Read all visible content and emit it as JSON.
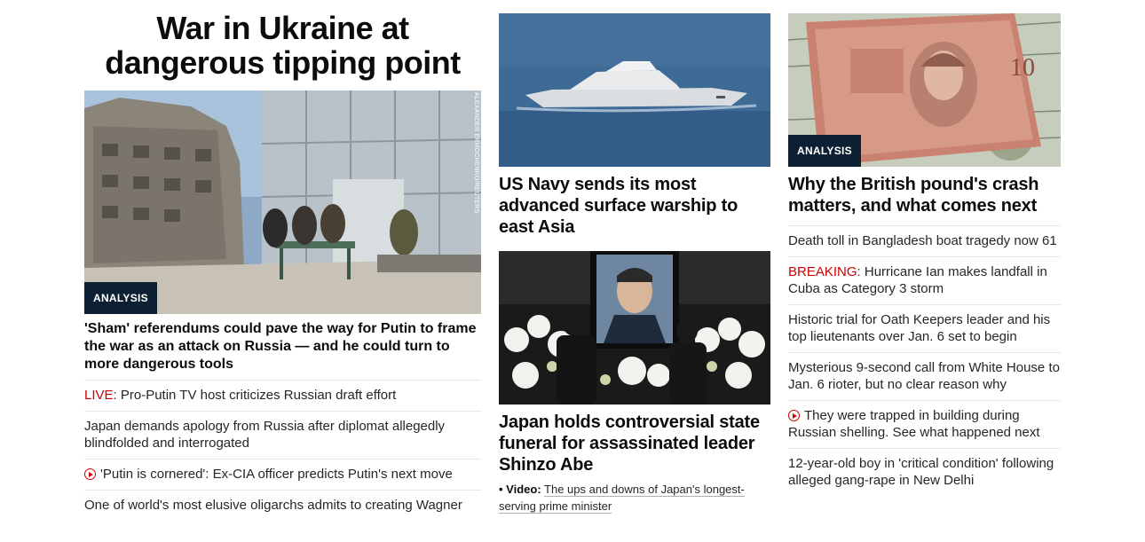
{
  "col1": {
    "headline": "War in Ukraine at dangerous tipping point",
    "image_credit": "ALEXANDER ERMOCHENKO/REUTERS",
    "badge": "ANALYSIS",
    "lead": "'Sham' referendums could pave the way for Putin to frame the war as an attack on Russia — and he could turn to more dangerous tools",
    "links": [
      {
        "prefix": "LIVE:",
        "text": "Pro-Putin TV host criticizes Russian draft effort",
        "video": false
      },
      {
        "prefix": "",
        "text": "Japan demands apology from Russia after diplomat allegedly blindfolded and interrogated",
        "video": false
      },
      {
        "prefix": "",
        "text": "'Putin is cornered': Ex-CIA officer predicts Putin's next move",
        "video": true
      },
      {
        "prefix": "",
        "text": "One of world's most elusive oligarchs admits to creating Wagner",
        "video": false
      }
    ]
  },
  "col2": {
    "story1": {
      "headline": "US Navy sends its most advanced surface warship to east Asia"
    },
    "story2": {
      "headline": "Japan holds controversial state funeral for assassinated leader Shinzo Abe",
      "video_label": "• Video:",
      "video_text": "The ups and downs of Japan's longest-serving prime minister"
    }
  },
  "col3": {
    "badge": "ANALYSIS",
    "headline": "Why the British pound's crash matters, and what comes next",
    "links": [
      {
        "prefix": "",
        "text": "Death toll in Bangladesh boat tragedy now 61",
        "video": false
      },
      {
        "prefix": "BREAKING:",
        "text": "Hurricane Ian makes landfall in Cuba as Category 3 storm",
        "video": false
      },
      {
        "prefix": "",
        "text": "Historic trial for Oath Keepers leader and his top lieutenants over Jan. 6 set to begin",
        "video": false
      },
      {
        "prefix": "",
        "text": "Mysterious 9-second call from White House to Jan. 6 rioter, but no clear reason why",
        "video": false
      },
      {
        "prefix": "",
        "text": "They were trapped in building during Russian shelling. See what happened next",
        "video": true
      },
      {
        "prefix": "",
        "text": "12-year-old boy in 'critical condition' following alleged gang-rape in New Delhi",
        "video": false
      }
    ]
  },
  "colors": {
    "accent_red": "#cc0000",
    "badge_bg": "#0c1f33"
  }
}
